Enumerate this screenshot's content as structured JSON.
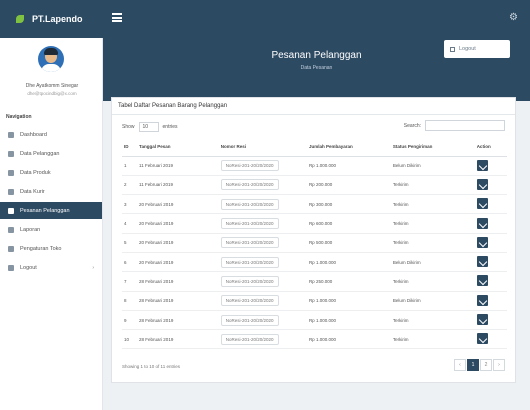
{
  "app": {
    "brand": "PT.Lapendo"
  },
  "user": {
    "name": "Dhe Ayatkomm Sinegar",
    "email": "dhe@tpocindbig@x.com"
  },
  "sidebar": {
    "heading": "Navigation",
    "items": [
      {
        "label": "Dashboard",
        "icon": "dashboard-icon"
      },
      {
        "label": "Data Pelanggan",
        "icon": "users-icon"
      },
      {
        "label": "Data Produk",
        "icon": "box-icon"
      },
      {
        "label": "Data Kurir",
        "icon": "truck-icon"
      },
      {
        "label": "Pesanan Pelanggan",
        "icon": "cart-icon",
        "active": true
      },
      {
        "label": "Laporan",
        "icon": "report-icon"
      },
      {
        "label": "Pengaturan Toko",
        "icon": "store-icon"
      },
      {
        "label": "Logout",
        "icon": "logout-icon",
        "has_caret": true
      }
    ]
  },
  "header": {
    "title": "Pesanan Pelanggan",
    "subtitle": "Data Pesanan",
    "logout": "Logout"
  },
  "card": {
    "title": "Tabel Daftar Pesanan Barang Pelanggan",
    "show_label": "Show",
    "show_value": "10",
    "entries_label": "entries",
    "search_label": "Search:"
  },
  "table": {
    "headers": [
      "ID",
      "Tanggal Pesan",
      "Nomor Resi",
      "Jumlah Pembayaran",
      "Status Pengiriman",
      "Action"
    ],
    "rows": [
      {
        "id": "1",
        "date": "11 Februari 2019",
        "resi": "NoResi-201-20/20/2020",
        "pay": "Rp 1.000.000",
        "status": "Belum Dikirim"
      },
      {
        "id": "2",
        "date": "11 Februari 2019",
        "resi": "NoResi-201-20/20/2020",
        "pay": "Rp 200.000",
        "status": "Terkirim"
      },
      {
        "id": "3",
        "date": "20 Februari 2019",
        "resi": "NoResi-201-20/20/2020",
        "pay": "Rp 300.000",
        "status": "Terkirim"
      },
      {
        "id": "4",
        "date": "20 Februari 2019",
        "resi": "NoResi-201-20/20/2020",
        "pay": "Rp 600.000",
        "status": "Terkirim"
      },
      {
        "id": "5",
        "date": "20 Februari 2019",
        "resi": "NoResi-201-20/20/2020",
        "pay": "Rp 500.000",
        "status": "Terkirim"
      },
      {
        "id": "6",
        "date": "20 Februari 2019",
        "resi": "NoResi-201-20/20/2020",
        "pay": "Rp 1.000.000",
        "status": "Belum Dikirim"
      },
      {
        "id": "7",
        "date": "28 Februari 2019",
        "resi": "NoResi-201-20/20/2020",
        "pay": "Rp 250.000",
        "status": "Terkirim"
      },
      {
        "id": "8",
        "date": "28 Februari 2019",
        "resi": "NoResi-201-20/20/2020",
        "pay": "Rp 1.000.000",
        "status": "Belum Dikirim"
      },
      {
        "id": "9",
        "date": "28 Februari 2019",
        "resi": "NoResi-201-20/20/2020",
        "pay": "Rp 1.000.000",
        "status": "Terkirim"
      },
      {
        "id": "10",
        "date": "28 Februari 2019",
        "resi": "NoResi-201-20/20/2020",
        "pay": "Rp 1.000.000",
        "status": "Terkirim"
      }
    ]
  },
  "footer": {
    "info": "Showing 1 to 10 of 11 entries",
    "prev": "‹",
    "page": "1",
    "next": "2",
    "last": "›"
  },
  "colors": {
    "primary": "#2d4a63",
    "accent": "#7fc241"
  }
}
